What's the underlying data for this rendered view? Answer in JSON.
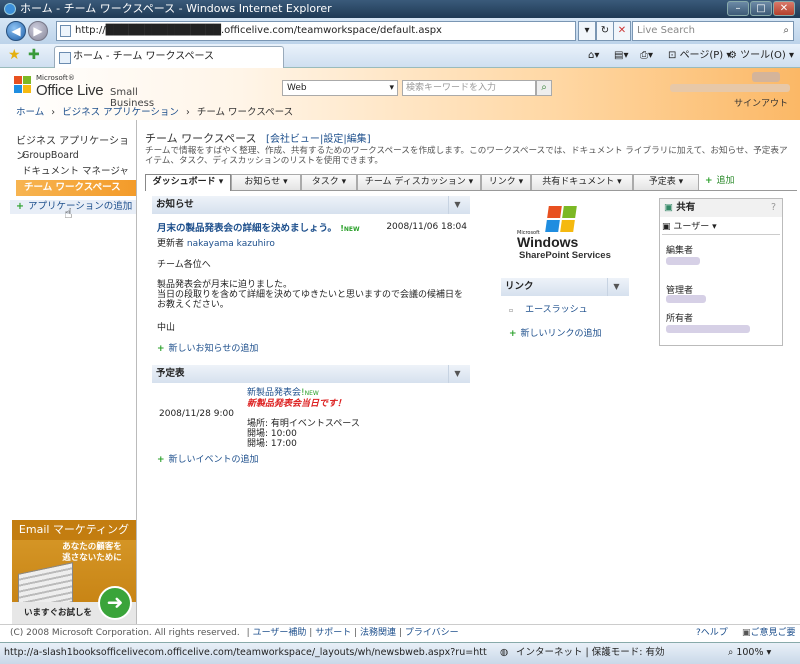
{
  "window": {
    "title": "ホーム - チーム ワークスペース - Windows Internet Explorer"
  },
  "browser": {
    "address": "http://███████████████.officelive.com/teamworkspace/default.aspx",
    "search_placeholder": "Live Search",
    "tab_title": "ホーム - チーム ワークスペース",
    "toolbar_page": "ページ(P)",
    "toolbar_tools": "ツール(O)"
  },
  "header": {
    "ms_label": "Microsoft®",
    "logo_text": "Office Live",
    "logo_suffix": "Small Business",
    "search_scope": "Web",
    "search_placeholder": "検索キーワードを入力",
    "signout": "サインアウト"
  },
  "breadcrumb": {
    "items": [
      "ホーム",
      "ビジネス アプリケーション",
      "チーム ワークスペース"
    ]
  },
  "leftnav": {
    "heading": "ビジネス アプリケーション",
    "items": [
      "GroupBoard",
      "ドキュメント マネージャ",
      "チーム ワークスペース"
    ],
    "add_label": "アプリケーションの追加"
  },
  "ad": {
    "title": "Email マーケティング",
    "line1": "あなたの顧客を",
    "line2": "逃さないために",
    "cta": "いますぐお試しを"
  },
  "page": {
    "title": "チーム ワークスペース",
    "links": [
      "会社ビュー",
      "設定",
      "編集"
    ],
    "description": "チームで情報をすばやく整理、作成、共有するためのワークスペースを作成します。このワークスペースでは、ドキュメント ライブラリに加えて、お知らせ、予定表アイテム、タスク、ディスカッションのリストを使用できます。"
  },
  "tabs": [
    "ダッシュボード",
    "お知らせ",
    "タスク",
    "チーム ディスカッション",
    "リンク",
    "共有ドキュメント",
    "予定表",
    "追加"
  ],
  "announcements": {
    "header": "お知らせ",
    "item_title": "月末の製品発表会の詳細を決めましょう。",
    "new_badge": "NEW",
    "date": "2008/11/06 18:04",
    "updated_by_label": "更新者",
    "updated_by": "nakayama kazuhiro",
    "body": [
      "チーム各位へ",
      "製品発表会が月末に迫りました。",
      "当日の段取りを含めて詳細を決めてゆきたいと思いますので会議の候補日をお教えください。",
      "中山"
    ],
    "add_label": "新しいお知らせの追加"
  },
  "calendar": {
    "header": "予定表",
    "date": "2008/11/28 9:00",
    "event_title": "新製品発表会",
    "new_badge": "NEW",
    "highlight": "新製品発表会当日です！",
    "location": "場所: 有明イベントスペース",
    "open": "開場: 10:00",
    "start": "開場: 17:00",
    "add_label": "新しいイベントの追加"
  },
  "sharepoint": {
    "ms": "Microsoft",
    "windows": "Windows",
    "sps": "SharePoint Services"
  },
  "links_part": {
    "header": "リンク",
    "item": "エースラッシュ",
    "add_label": "新しいリンクの追加"
  },
  "share": {
    "header": "共有",
    "help": "?",
    "users": "ユーザー",
    "editor": "編集者",
    "manager": "管理者",
    "owner": "所有者"
  },
  "footer": {
    "copyright": "(C) 2008 Microsoft Corporation. All rights reserved.",
    "links": [
      "ユーザー補助",
      "サポート",
      "法務関連",
      "プライバシー"
    ],
    "help": "ヘルプ",
    "feedback": "ご意見ご要望"
  },
  "status": {
    "url": "http://a-slash1booksofficelivecom.officelive.com/teamworkspace/_layouts/wh/newsbweb.aspx?ru=htt",
    "zone": "インターネット | 保護モード: 有効",
    "zoom": "100%"
  }
}
